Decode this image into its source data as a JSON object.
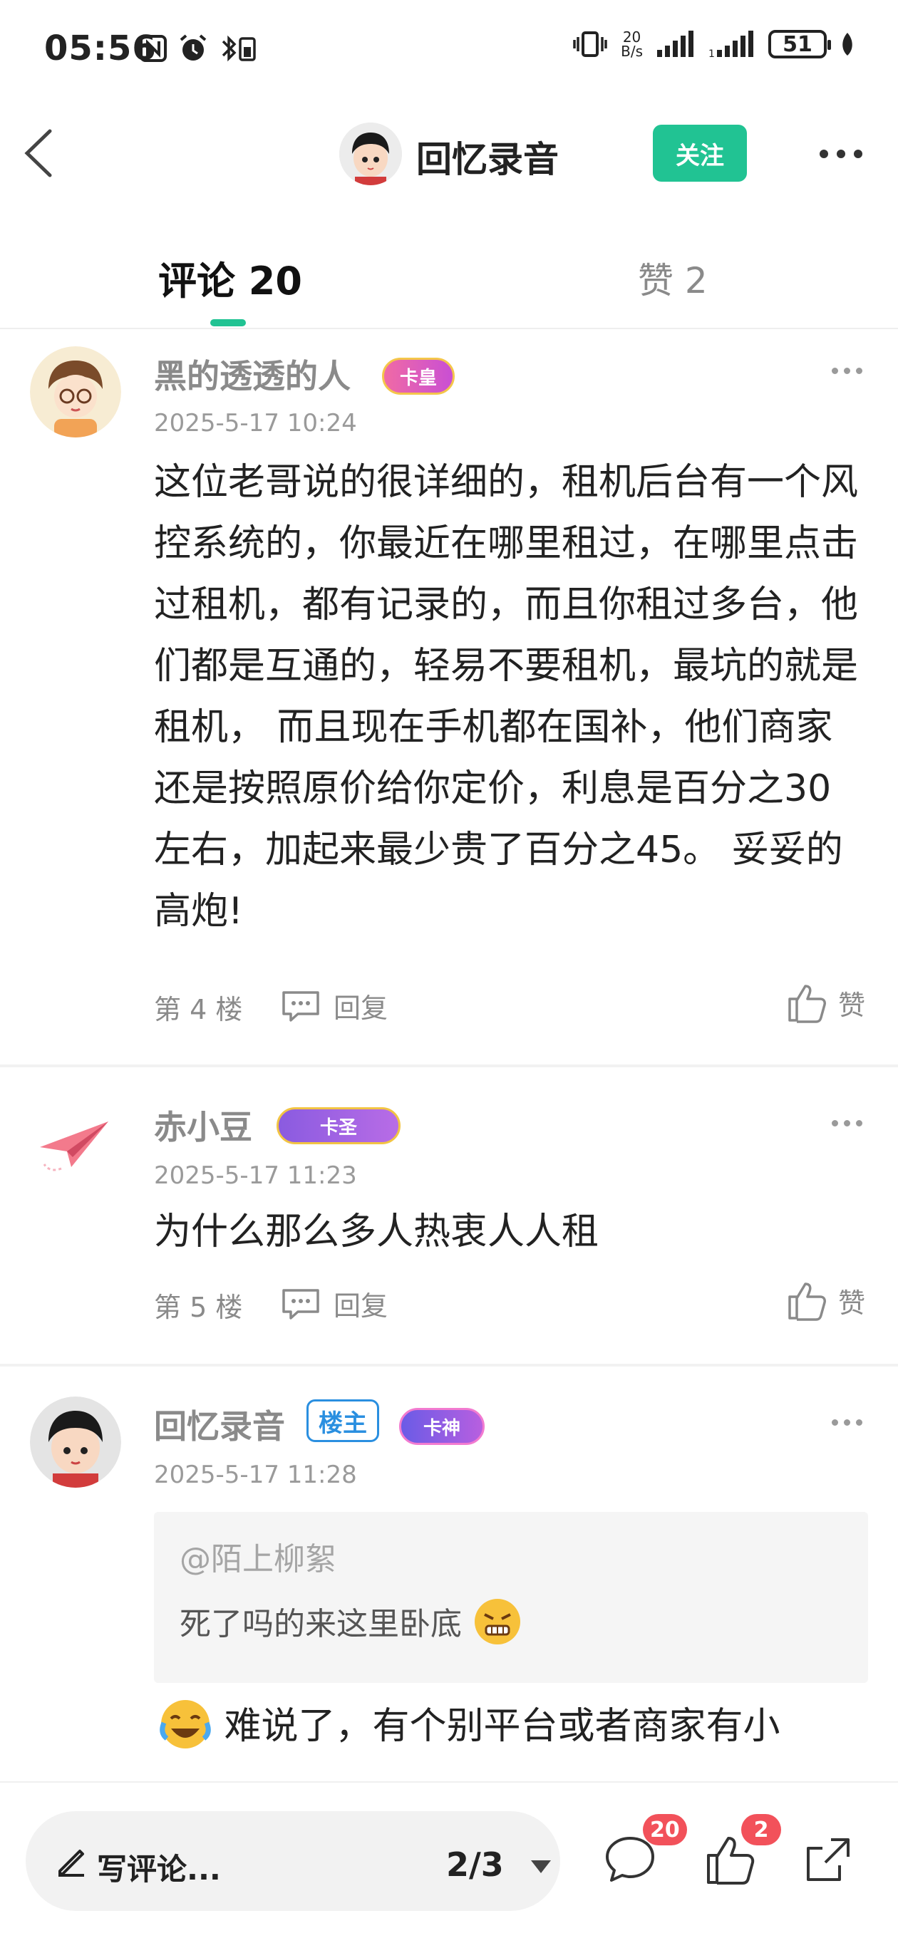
{
  "status_bar": {
    "time": "05:56",
    "net_speed_value": "20",
    "net_speed_unit": "B/s",
    "battery": "51"
  },
  "nav": {
    "title": "回忆录音",
    "follow_label": "关注"
  },
  "tabs": {
    "comments_label": "评论 20",
    "likes_label": "赞 2"
  },
  "comments": [
    {
      "username": "黑的透透的人",
      "badge": "卡皇",
      "date": "2025-5-17 10:24",
      "text": "这位老哥说的很详细的，租机后台有一个风控系统的，你最近在哪里租过，在哪里点击过租机，都有记录的，而且你租过多台，他们都是互通的，轻易不要租机，最坑的就是租机， 而且现在手机都在国补，他们商家还是按照原价给你定价，利息是百分之30左右，加起来最少贵了百分之45。 妥妥的高炮!",
      "floor": "第 4 楼",
      "reply_label": "回复",
      "like_label": "赞"
    },
    {
      "username": "赤小豆",
      "badge": "卡圣",
      "date": "2025-5-17 11:23",
      "text": "为什么那么多人热衷人人租",
      "floor": "第 5 楼",
      "reply_label": "回复",
      "like_label": "赞"
    },
    {
      "username": "回忆录音",
      "op_badge": "楼主",
      "badge": "卡神",
      "date": "2025-5-17 11:28",
      "quote_user": "@陌上柳絮",
      "quote_text": "死了吗的来这里卧底",
      "text": "难说了，有个别平台或者商家有小"
    }
  ],
  "bottom_bar": {
    "write_label": "写评论...",
    "page_indicator": "2/3",
    "comment_count": "20",
    "like_count": "2"
  },
  "colors": {
    "accent": "#21c393",
    "badge_red": "#f2515a",
    "op_blue": "#2a8fe0"
  }
}
